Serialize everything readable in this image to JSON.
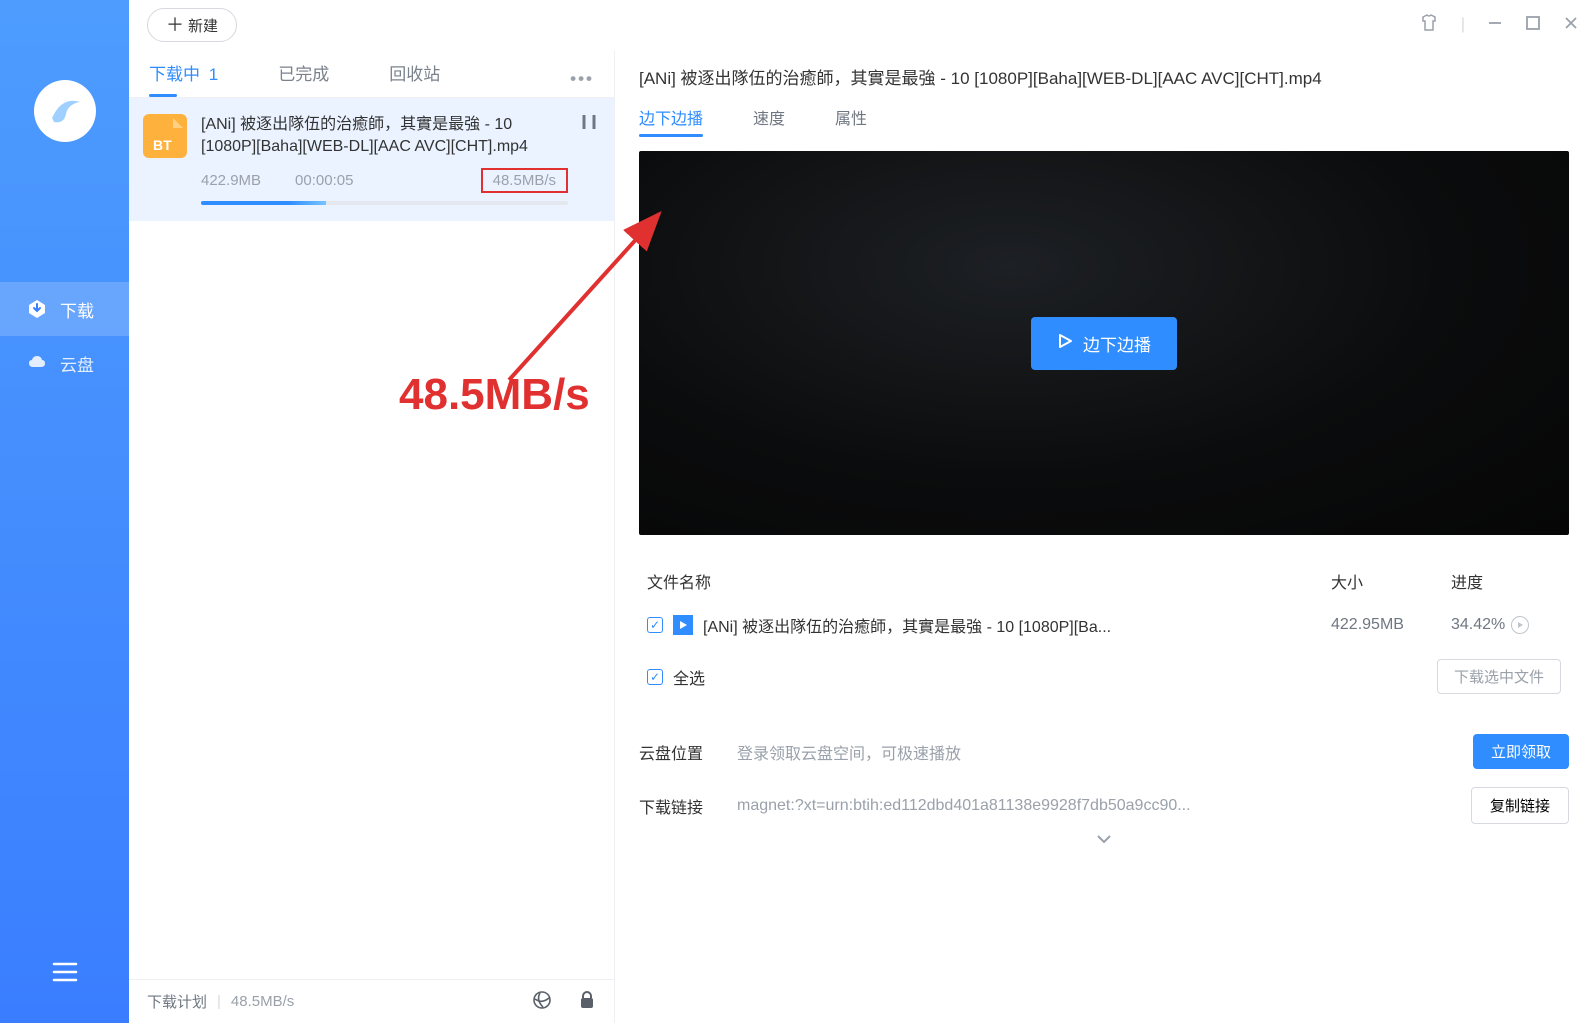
{
  "colors": {
    "accent": "#2f8dff",
    "danger": "#e03030"
  },
  "topbar": {
    "new_btn": "新建"
  },
  "sidebar": {
    "items": [
      {
        "label": "下载"
      },
      {
        "label": "云盘"
      }
    ]
  },
  "tabs": {
    "downloading": {
      "label": "下载中",
      "count": "1"
    },
    "completed": {
      "label": "已完成"
    },
    "recycle": {
      "label": "回收站"
    }
  },
  "download": {
    "title": "[ANi] 被逐出隊伍的治癒師，其實是最強 - 10 [1080P][Baha][WEB-DL][AAC AVC][CHT].mp4",
    "size": "422.9MB",
    "elapsed": "00:00:05",
    "speed": "48.5MB/s",
    "progress_pct": 34
  },
  "annotation": {
    "text": "48.5MB/s"
  },
  "footer": {
    "plan": "下载计划",
    "speed": "48.5MB/s"
  },
  "detail": {
    "title": "[ANi] 被逐出隊伍的治癒師，其實是最強 - 10 [1080P][Baha][WEB-DL][AAC AVC][CHT].mp4",
    "tabs": {
      "play": "边下边播",
      "speed": "速度",
      "props": "属性"
    },
    "play_btn": "边下边播",
    "table": {
      "head_name": "文件名称",
      "head_size": "大小",
      "head_progress": "进度",
      "row_name": "[ANi] 被逐出隊伍的治癒師，其實是最強 - 10 [1080P][Ba...",
      "row_size": "422.95MB",
      "row_progress": "34.42%",
      "select_all": "全选",
      "dl_selected": "下载选中文件"
    },
    "cloud": {
      "label": "云盘位置",
      "value": "登录领取云盘空间，可极速播放",
      "btn": "立即领取"
    },
    "link": {
      "label": "下载链接",
      "value": "magnet:?xt=urn:btih:ed112dbd401a81138e9928f7db50a9cc90...",
      "btn": "复制链接"
    }
  }
}
